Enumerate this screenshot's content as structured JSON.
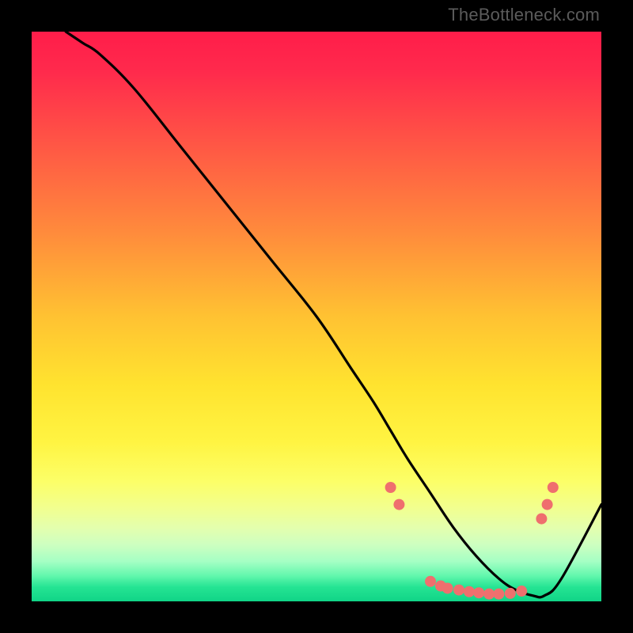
{
  "watermark": "TheBottleneck.com",
  "chart_data": {
    "type": "line",
    "title": "",
    "xlabel": "",
    "ylabel": "",
    "xlim": [
      0,
      100
    ],
    "ylim": [
      0,
      100
    ],
    "grid": false,
    "legend": false,
    "background_gradient": {
      "type": "vertical",
      "stops": [
        {
          "offset": 0.0,
          "color": "#ff1d4a"
        },
        {
          "offset": 0.07,
          "color": "#ff2a4c"
        },
        {
          "offset": 0.2,
          "color": "#ff5745"
        },
        {
          "offset": 0.35,
          "color": "#ff8a3c"
        },
        {
          "offset": 0.5,
          "color": "#ffc232"
        },
        {
          "offset": 0.62,
          "color": "#ffe32f"
        },
        {
          "offset": 0.72,
          "color": "#fff442"
        },
        {
          "offset": 0.79,
          "color": "#fcff68"
        },
        {
          "offset": 0.835,
          "color": "#f2ff8e"
        },
        {
          "offset": 0.87,
          "color": "#e4ffad"
        },
        {
          "offset": 0.9,
          "color": "#ceffc0"
        },
        {
          "offset": 0.93,
          "color": "#a5ffc4"
        },
        {
          "offset": 0.955,
          "color": "#62f7ad"
        },
        {
          "offset": 0.975,
          "color": "#25e493"
        },
        {
          "offset": 1.0,
          "color": "#10d487"
        }
      ]
    },
    "series": [
      {
        "name": "bottleneck-curve",
        "color": "#000000",
        "x": [
          6,
          9,
          12,
          18,
          26,
          34,
          42,
          50,
          56,
          60,
          63,
          66,
          70,
          74,
          78,
          82,
          85,
          88,
          90,
          93,
          100
        ],
        "y": [
          100,
          98,
          96,
          90,
          80,
          70,
          60,
          50,
          41,
          35,
          30,
          25,
          19,
          13,
          8,
          4,
          2,
          1,
          1,
          4,
          17
        ]
      }
    ],
    "markers": {
      "name": "highlight-points",
      "color": "#ef6f6e",
      "radius": 7,
      "points": [
        {
          "x": 63.0,
          "y": 20.0
        },
        {
          "x": 64.5,
          "y": 17.0
        },
        {
          "x": 70.0,
          "y": 3.5
        },
        {
          "x": 71.8,
          "y": 2.7
        },
        {
          "x": 73.0,
          "y": 2.3
        },
        {
          "x": 75.0,
          "y": 2.0
        },
        {
          "x": 76.8,
          "y": 1.7
        },
        {
          "x": 78.5,
          "y": 1.5
        },
        {
          "x": 80.3,
          "y": 1.3
        },
        {
          "x": 82.0,
          "y": 1.3
        },
        {
          "x": 84.0,
          "y": 1.4
        },
        {
          "x": 86.0,
          "y": 1.8
        },
        {
          "x": 89.5,
          "y": 14.5
        },
        {
          "x": 90.5,
          "y": 17.0
        },
        {
          "x": 91.5,
          "y": 20.0
        }
      ]
    }
  }
}
